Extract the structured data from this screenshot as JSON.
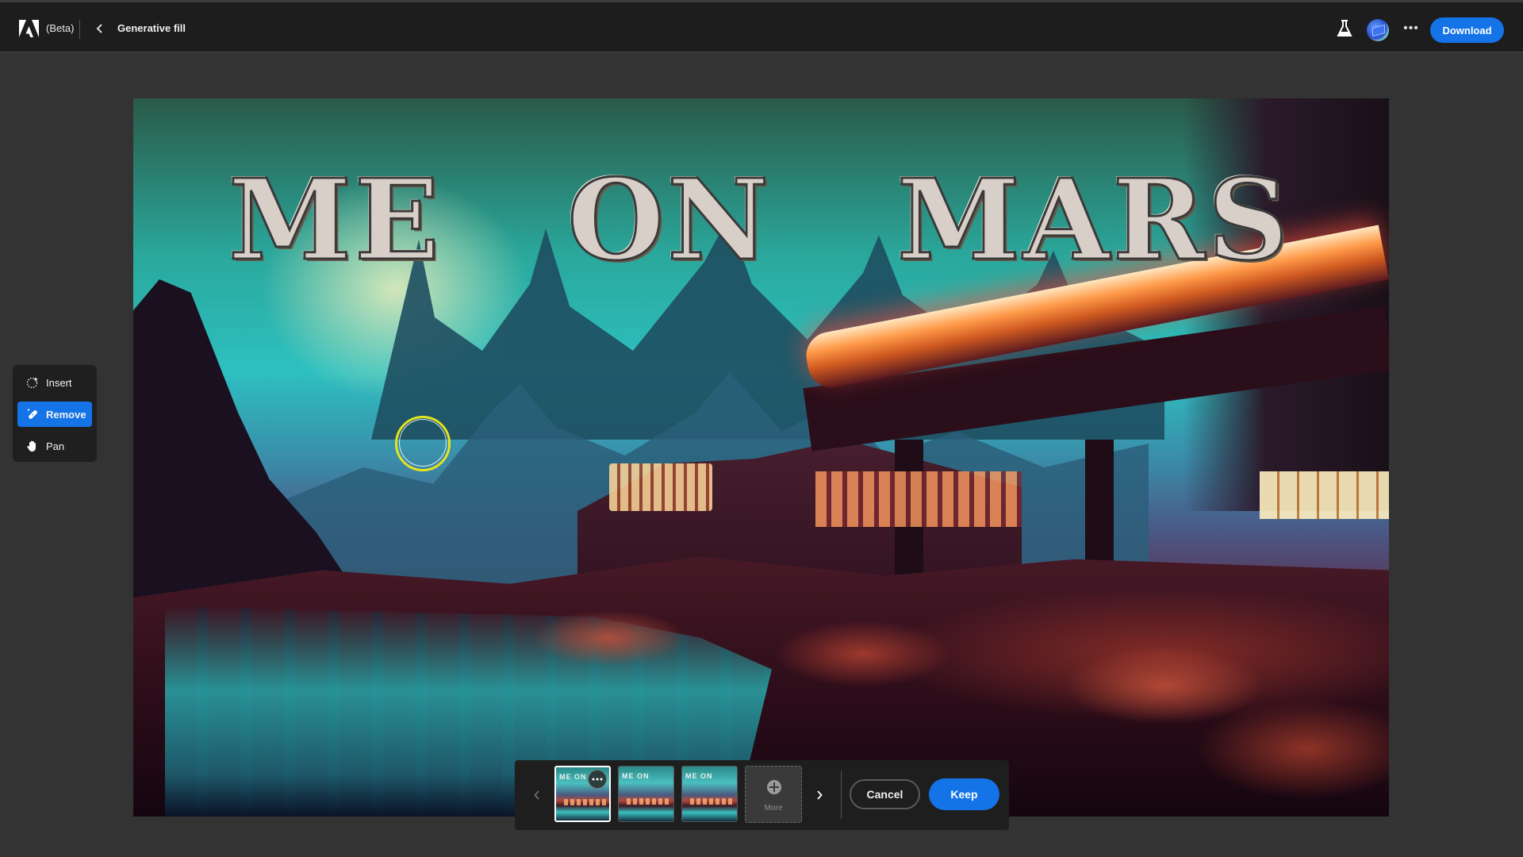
{
  "app": {
    "badge": "(Beta)",
    "title": "Generative fill",
    "accent": "#1473e6"
  },
  "header": {
    "logo_icon": "adobe-logo",
    "back_icon": "chevron-left",
    "labs_icon": "flask-icon",
    "avatar_icon": "user-avatar",
    "more_icon": "ellipsis",
    "more_label": "•••",
    "download_label": "Download"
  },
  "tools": {
    "items": [
      {
        "id": "insert",
        "label": "Insert",
        "icon": "insert-dotted-circle-sparkle",
        "active": false
      },
      {
        "id": "remove",
        "label": "Remove",
        "icon": "bandage-sparkle",
        "active": true
      },
      {
        "id": "pan",
        "label": "Pan",
        "icon": "hand",
        "active": false
      }
    ]
  },
  "canvas": {
    "headline_words": [
      "ME",
      "ON",
      "MARS"
    ],
    "brush_cursor_color": "#e4e41c"
  },
  "variations": {
    "prev_icon": "chevron-left",
    "next_icon": "chevron-right",
    "thumbnails": [
      {
        "label": "ME ON",
        "selected": true,
        "has_options": true,
        "options_label": "•••"
      },
      {
        "label": "ME ON",
        "selected": false
      },
      {
        "label": "ME ON",
        "selected": false
      }
    ],
    "more_label": "More",
    "more_icon": "plus-circle",
    "cancel_label": "Cancel",
    "keep_label": "Keep"
  }
}
